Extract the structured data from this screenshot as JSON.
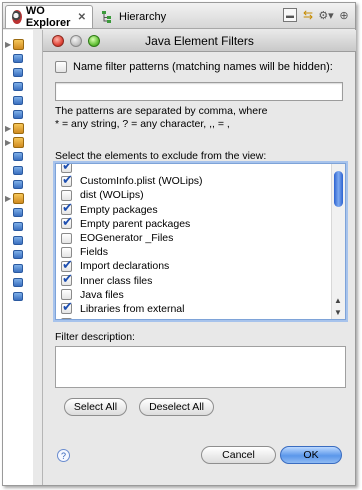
{
  "tabs": [
    {
      "label": "WO Explorer",
      "active": true
    },
    {
      "label": "Hierarchy",
      "active": false
    }
  ],
  "tab_close_glyph": "✕",
  "view_tool_icons": [
    "minimize-icon",
    "link-with-editor-icon",
    "view-menu-icon",
    "maximize-icon"
  ],
  "dialog": {
    "title": "Java Element Filters",
    "name_filter": {
      "label": "Name filter patterns (matching names will be hidden):",
      "checked": false,
      "value": ""
    },
    "help_line1": "The patterns are separated by comma, where",
    "help_line2": "* = any string, ? = any character, ,, = ,",
    "select_label": "Select the elements to exclude from the view:",
    "elements": [
      {
        "label": "CustomInfo.plist (WOLips)",
        "checked": true
      },
      {
        "label": "dist (WOLips)",
        "checked": false
      },
      {
        "label": "Empty packages",
        "checked": true
      },
      {
        "label": "Empty parent packages",
        "checked": true
      },
      {
        "label": "EOGenerator _Files",
        "checked": false
      },
      {
        "label": "Fields",
        "checked": false
      },
      {
        "label": "Import declarations",
        "checked": true
      },
      {
        "label": "Inner class files",
        "checked": true
      },
      {
        "label": "Java files",
        "checked": false
      },
      {
        "label": "Libraries from external",
        "checked": true
      }
    ],
    "filter_description_label": "Filter description:",
    "filter_description": "",
    "buttons": {
      "select_all": "Select All",
      "deselect_all": "Deselect All",
      "cancel": "Cancel",
      "ok": "OK"
    },
    "help_glyph": "?"
  },
  "colors": {
    "accent": "#3a6cc0",
    "checkmark": "#1e4fb0",
    "list_focus": "#a7c3ec"
  }
}
